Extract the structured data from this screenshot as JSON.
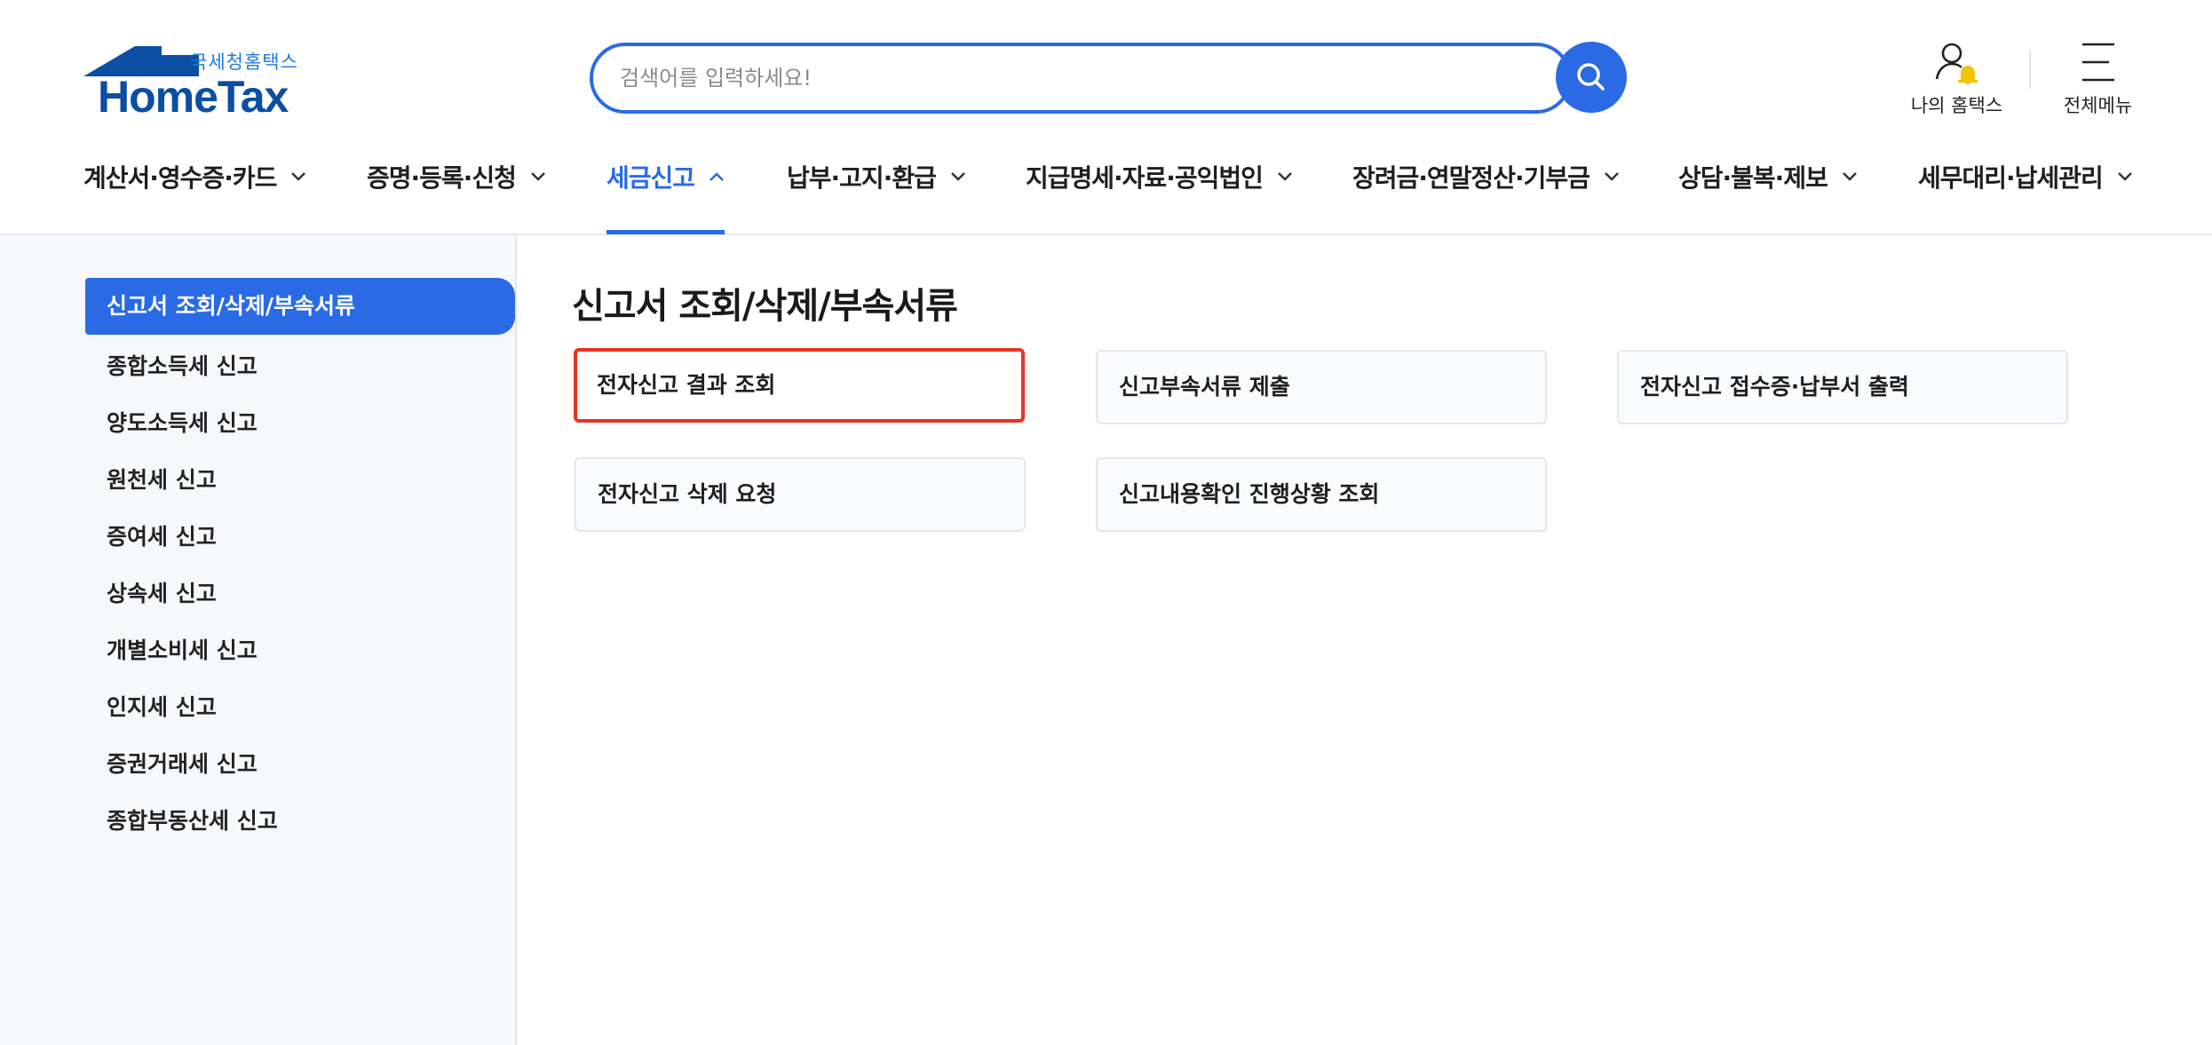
{
  "logo": {
    "sub_text": "국세청홈택스",
    "main_text": "HomeTax",
    "brand_color": "#0b4ea2",
    "sub_color": "#1f7be0"
  },
  "search": {
    "placeholder": "검색어를 입력하세요!",
    "value": "",
    "icon": "search-icon"
  },
  "utility": {
    "my_hometax_label": "나의 홈택스",
    "my_hometax_icon": "user-bell-icon",
    "all_menu_label": "전체메뉴",
    "all_menu_icon": "hamburger-icon"
  },
  "gnb": {
    "items": [
      {
        "label": "계산서·영수증·카드",
        "active": false
      },
      {
        "label": "증명·등록·신청",
        "active": false
      },
      {
        "label": "세금신고",
        "active": true
      },
      {
        "label": "납부·고지·환급",
        "active": false
      },
      {
        "label": "지급명세·자료·공익법인",
        "active": false
      },
      {
        "label": "장려금·연말정산·기부금",
        "active": false
      },
      {
        "label": "상담·불복·제보",
        "active": false
      },
      {
        "label": "세무대리·납세관리",
        "active": false
      }
    ]
  },
  "sidebar": {
    "active_item": "신고서 조회/삭제/부속서류",
    "items": [
      {
        "label": "종합소득세 신고"
      },
      {
        "label": "양도소득세 신고"
      },
      {
        "label": "원천세 신고"
      },
      {
        "label": "증여세 신고"
      },
      {
        "label": "상속세 신고"
      },
      {
        "label": "개별소비세 신고"
      },
      {
        "label": "인지세 신고"
      },
      {
        "label": "증권거래세 신고"
      },
      {
        "label": "종합부동산세 신고"
      }
    ]
  },
  "main": {
    "title": "신고서 조회/삭제/부속서류",
    "cards": [
      {
        "label": "전자신고 결과 조회",
        "highlighted": true
      },
      {
        "label": "신고부속서류 제출",
        "highlighted": false
      },
      {
        "label": "전자신고 접수증·납부서 출력",
        "highlighted": false
      },
      {
        "label": "전자신고 삭제 요청",
        "highlighted": false
      },
      {
        "label": "신고내용확인 진행상황 조회",
        "highlighted": false
      }
    ]
  },
  "colors": {
    "accent": "#2a6ae4",
    "highlight_border": "#e8331e",
    "sidebar_bg": "#f6f8fb",
    "bell": "#f2c200"
  }
}
